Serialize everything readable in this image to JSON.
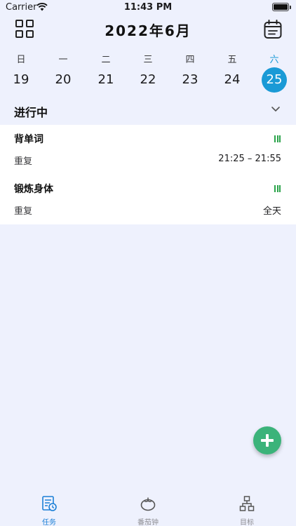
{
  "status_bar": {
    "carrier": "Carrier",
    "time": "11:43 PM"
  },
  "header": {
    "title": "2022年6月"
  },
  "week": [
    {
      "label": "日",
      "date": "19",
      "selected": false
    },
    {
      "label": "一",
      "date": "20",
      "selected": false
    },
    {
      "label": "二",
      "date": "21",
      "selected": false
    },
    {
      "label": "三",
      "date": "22",
      "selected": false
    },
    {
      "label": "四",
      "date": "23",
      "selected": false
    },
    {
      "label": "五",
      "date": "24",
      "selected": false
    },
    {
      "label": "六",
      "date": "25",
      "selected": true
    }
  ],
  "section": {
    "title": "进行中"
  },
  "tasks": [
    {
      "name": "背单词",
      "repeat": "重复",
      "time": "21:25 – 21:55"
    },
    {
      "name": "锻炼身体",
      "repeat": "重复",
      "time": "全天"
    }
  ],
  "tabs": [
    {
      "label": "任务",
      "active": true,
      "icon": "task-list-icon"
    },
    {
      "label": "番茄钟",
      "active": false,
      "icon": "tomato-icon"
    },
    {
      "label": "目标",
      "active": false,
      "icon": "hierarchy-icon"
    }
  ],
  "colors": {
    "background": "#eef1fd",
    "accent": "#1a9ad6",
    "task_mark": "#2aa34a",
    "fab": "#3bb37a",
    "tab_active": "#1a7fd6"
  }
}
